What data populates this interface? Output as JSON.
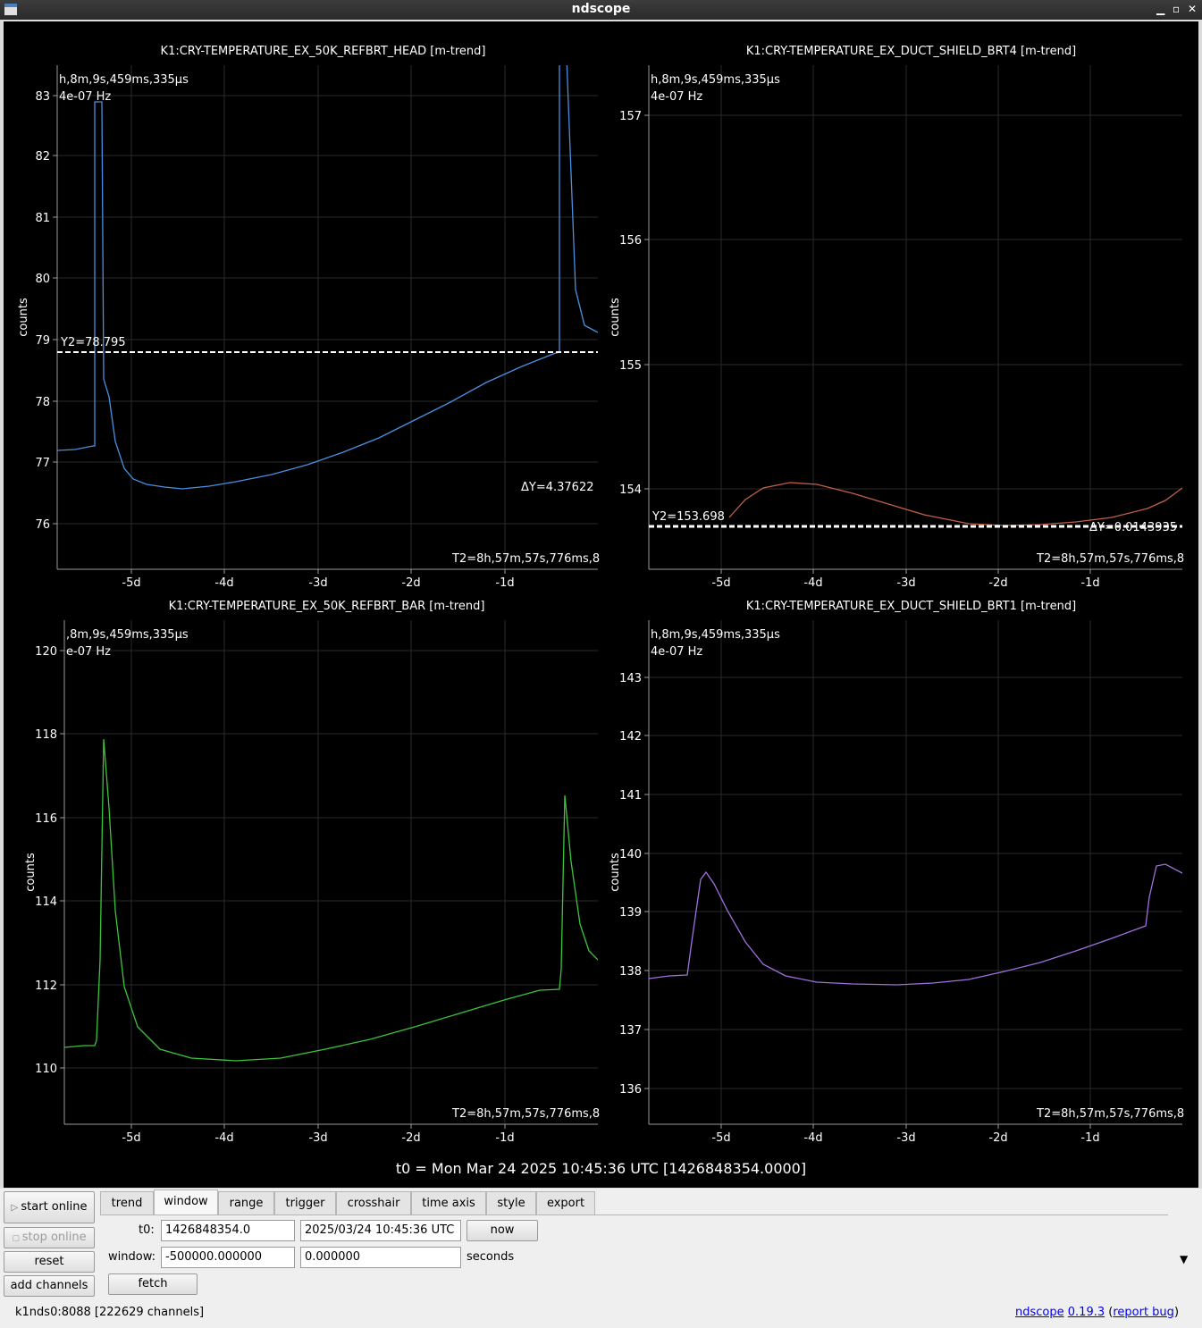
{
  "window": {
    "title": "ndscope"
  },
  "plots": [
    {
      "title": "K1:CRY-TEMPERATURE_EX_50K_REFBRT_HEAD [m-trend]",
      "ylabel": "counts",
      "color": "#4a90e2",
      "yticks": [
        "76",
        "77",
        "78",
        "79",
        "80",
        "81",
        "82",
        "83"
      ],
      "xticks": [
        "-5d",
        "-4d",
        "-3d",
        "-2d",
        "-1d"
      ],
      "cursor_time": "h,8m,9s,459ms,335µs",
      "cursor_freq": "4e-07 Hz",
      "y2_label": "Y2=78.795",
      "dy_label": "ΔY=4.37622",
      "t2_label": "T2=8h,57m,57s,776ms,8"
    },
    {
      "title": "K1:CRY-TEMPERATURE_EX_DUCT_SHIELD_BRT4 [m-trend]",
      "ylabel": "counts",
      "color": "#c0604a",
      "yticks": [
        "154",
        "155",
        "156",
        "157"
      ],
      "xticks": [
        "-5d",
        "-4d",
        "-3d",
        "-2d",
        "-1d"
      ],
      "cursor_time": "h,8m,9s,459ms,335µs",
      "cursor_freq": "4e-07 Hz",
      "y2_label": "Y2=153.698",
      "dy_label": "ΔY=0.0143935",
      "t2_label": "T2=8h,57m,57s,776ms,8"
    },
    {
      "title": "K1:CRY-TEMPERATURE_EX_50K_REFBRT_BAR [m-trend]",
      "ylabel": "counts",
      "color": "#3cc43c",
      "yticks": [
        "110",
        "112",
        "114",
        "116",
        "118",
        "120"
      ],
      "xticks": [
        "-5d",
        "-4d",
        "-3d",
        "-2d",
        "-1d"
      ],
      "cursor_time": ",8m,9s,459ms,335µs",
      "cursor_freq": "e-07 Hz",
      "t2_label": "T2=8h,57m,57s,776ms,8"
    },
    {
      "title": "K1:CRY-TEMPERATURE_EX_DUCT_SHIELD_BRT1 [m-trend]",
      "ylabel": "counts",
      "color": "#a070e0",
      "yticks": [
        "136",
        "137",
        "138",
        "139",
        "140",
        "141",
        "142",
        "143"
      ],
      "xticks": [
        "-5d",
        "-4d",
        "-3d",
        "-2d",
        "-1d"
      ],
      "cursor_time": "h,8m,9s,459ms,335µs",
      "cursor_freq": "4e-07 Hz",
      "t2_label": "T2=8h,57m,57s,776ms,8"
    }
  ],
  "t0_line": "t0 = Mon Mar 24 2025 10:45:36 UTC [1426848354.0000]",
  "side": {
    "start_online": "start online",
    "stop_online": "stop online",
    "reset": "reset",
    "add_channels": "add channels"
  },
  "tabs": [
    "trend",
    "window",
    "range",
    "trigger",
    "crosshair",
    "time axis",
    "style",
    "export"
  ],
  "form": {
    "t0_label": "t0:",
    "t0_gps": "1426848354.0",
    "t0_utc": "2025/03/24 10:45:36 UTC",
    "now": "now",
    "window_label": "window:",
    "window_start": "-500000.000000",
    "window_end": "0.000000",
    "seconds": "seconds",
    "fetch": "fetch"
  },
  "status": {
    "server": "k1nds0:8088  [222629 channels]",
    "app": "ndscope",
    "version": "0.19.3",
    "report": "report bug"
  }
}
